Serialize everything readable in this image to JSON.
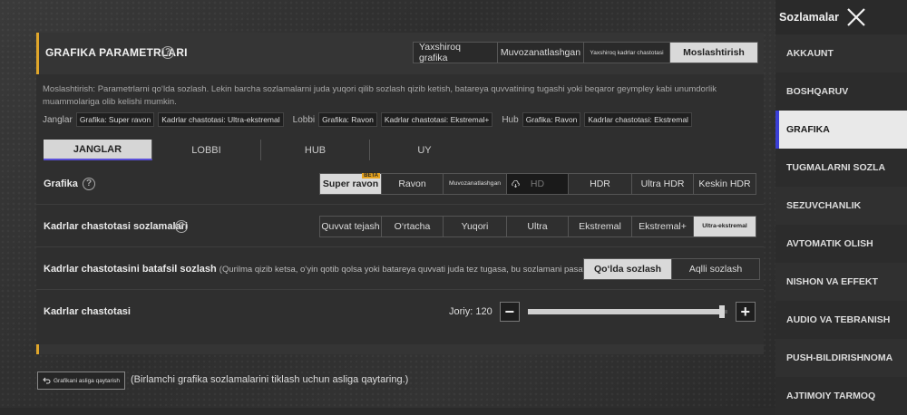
{
  "header": {
    "title": "GRAFIKA PARAMETRLARI",
    "presets": [
      {
        "label": "Yaxshiroq grafika",
        "active": false,
        "small": false
      },
      {
        "label": "Muvozanatlashgan",
        "active": false,
        "small": false
      },
      {
        "label": "Yaxshiroq kadrlar chastotasi",
        "active": false,
        "small": true
      },
      {
        "label": "Moslashtirish",
        "active": true,
        "small": false
      }
    ]
  },
  "description": "Moslashtirish: Parametrlarni qo‘lda sozlash. Lekin barcha sozlamalarni juda yuqori qilib sozlash qizib ketish, batareya quvvatining tugashi yoki beqaror geympley kabi unumdorlik muammolariga olib kelishi mumkin.",
  "summary": {
    "janglar_label": "Janglar",
    "janglar_graphics": "Grafika: Super ravon",
    "janglar_fps": "Kadrlar chastotasi: Ultra-ekstremal",
    "lobbi_label": "Lobbi",
    "lobbi_graphics": "Grafika: Ravon",
    "lobbi_fps": "Kadrlar chastotasi: Ekstremal+",
    "hub_label": "Hub",
    "hub_graphics": "Grafika: Ravon",
    "hub_fps": "Kadrlar chastotasi: Ekstremal"
  },
  "tabs": [
    {
      "label": "JANGLAR",
      "active": true
    },
    {
      "label": "LOBBI",
      "active": false
    },
    {
      "label": "HUB",
      "active": false
    },
    {
      "label": "UY",
      "active": false
    }
  ],
  "graphics": {
    "label": "Grafika",
    "options": [
      {
        "label": "Super ravon",
        "active": true,
        "beta": "BETA"
      },
      {
        "label": "Ravon"
      },
      {
        "label": "Muvozanatlashgan",
        "small": true
      },
      {
        "label": "HD",
        "disabled": true
      },
      {
        "label": "HDR"
      },
      {
        "label": "Ultra HDR"
      },
      {
        "label": "Keskin HDR"
      }
    ]
  },
  "fps_settings": {
    "label": "Kadrlar chastotasi sozlamalari",
    "options": [
      {
        "label": "Quvvat tejash"
      },
      {
        "label": "O‘rtacha"
      },
      {
        "label": "Yuqori"
      },
      {
        "label": "Ultra"
      },
      {
        "label": "Ekstremal"
      },
      {
        "label": "Ekstremal+"
      },
      {
        "label": "Ultra-ekstremal",
        "active": true,
        "small": true
      }
    ]
  },
  "fps_detail": {
    "label": "Kadrlar chastotasini batafsil sozlash",
    "sublabel": "(Qurilma qizib ketsa, o‘yin qotib qolsa yoki batareya quvvati juda tez tugasa, bu sozlamani pasayt",
    "options": [
      {
        "label": "Qo‘lda sozlash",
        "active": true
      },
      {
        "label": "Aqlli sozlash"
      }
    ]
  },
  "fps_slider": {
    "label": "Kadrlar chastotasi",
    "current": "Joriy: 120",
    "level": 0.98
  },
  "reset": {
    "button": "Grafikani asliga qaytarish",
    "note": "(Birlamchi grafika sozlamalarini tiklash uchun asliga qaytaring.)"
  },
  "sidebar": {
    "title": "Sozlamalar",
    "items": [
      {
        "label": "AKKAUNT"
      },
      {
        "label": "BOSHQARUV"
      },
      {
        "label": "GRAFIKA",
        "active": true
      },
      {
        "label": "TUGMALARNI SOZLA"
      },
      {
        "label": "SEZUVCHANLIK"
      },
      {
        "label": "AVTOMATIK OLISH"
      },
      {
        "label": "NISHON VA EFFEKT"
      },
      {
        "label": "AUDIO VA TEBRANISH"
      },
      {
        "label": "PUSH-BILDIRISHNOMA"
      },
      {
        "label": "AJTIMOIY TARMOQ"
      }
    ]
  },
  "colors": {
    "accent": "#e0a62a",
    "active_bar": "#3a3fd6"
  }
}
